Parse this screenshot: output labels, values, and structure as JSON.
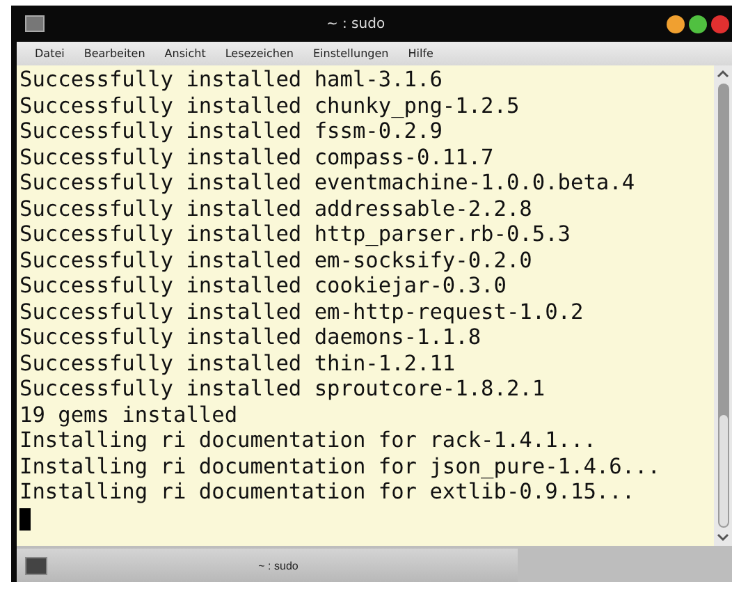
{
  "window": {
    "title": "~ : sudo"
  },
  "menu": [
    "Datei",
    "Bearbeiten",
    "Ansicht",
    "Lesezeichen",
    "Einstellungen",
    "Hilfe"
  ],
  "terminal": {
    "lines": [
      "Successfully installed haml-3.1.6",
      "Successfully installed chunky_png-1.2.5",
      "Successfully installed fssm-0.2.9",
      "Successfully installed compass-0.11.7",
      "Successfully installed eventmachine-1.0.0.beta.4",
      "Successfully installed addressable-2.2.8",
      "Successfully installed http_parser.rb-0.5.3",
      "Successfully installed em-socksify-0.2.0",
      "Successfully installed cookiejar-0.3.0",
      "Successfully installed em-http-request-1.0.2",
      "Successfully installed daemons-1.1.8",
      "Successfully installed thin-1.2.11",
      "Successfully installed sproutcore-1.8.2.1",
      "19 gems installed",
      "Installing ri documentation for rack-1.4.1...",
      "Installing ri documentation for json_pure-1.4.6...",
      "Installing ri documentation for extlib-0.9.15..."
    ]
  },
  "tabs": [
    {
      "label": "~ : sudo",
      "selected": true
    }
  ]
}
